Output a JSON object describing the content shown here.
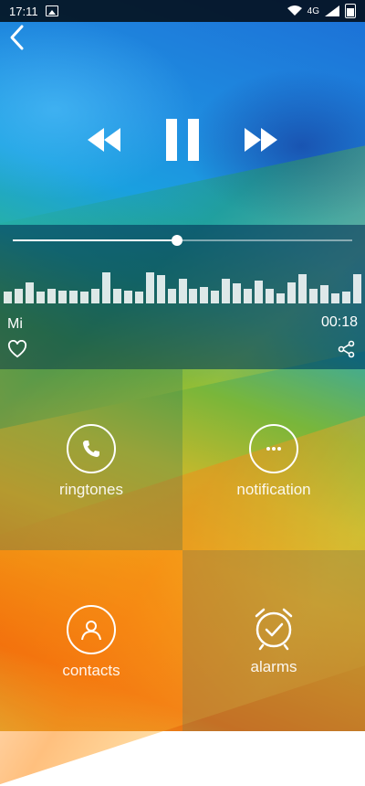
{
  "status": {
    "time": "17:11",
    "network": "4G"
  },
  "player": {
    "progress_fraction": 0.485,
    "song_title": "Mi",
    "elapsed": "00:18",
    "waveform": [
      0.35,
      0.45,
      0.65,
      0.35,
      0.45,
      0.4,
      0.4,
      0.35,
      0.45,
      0.95,
      0.45,
      0.4,
      0.35,
      0.95,
      0.85,
      0.45,
      0.75,
      0.45,
      0.5,
      0.4,
      0.75,
      0.6,
      0.45,
      0.7,
      0.45,
      0.3,
      0.65,
      0.9,
      0.45,
      0.55,
      0.3,
      0.35,
      0.9
    ]
  },
  "tiles": {
    "ringtones": "ringtones",
    "notification": "notification",
    "contacts": "contacts",
    "alarms": "alarms"
  },
  "icons": [
    "back-icon",
    "rewind-icon",
    "pause-icon",
    "fast-forward-icon",
    "heart-icon",
    "share-icon",
    "phone-icon",
    "chat-icon",
    "person-icon",
    "alarm-clock-icon"
  ]
}
